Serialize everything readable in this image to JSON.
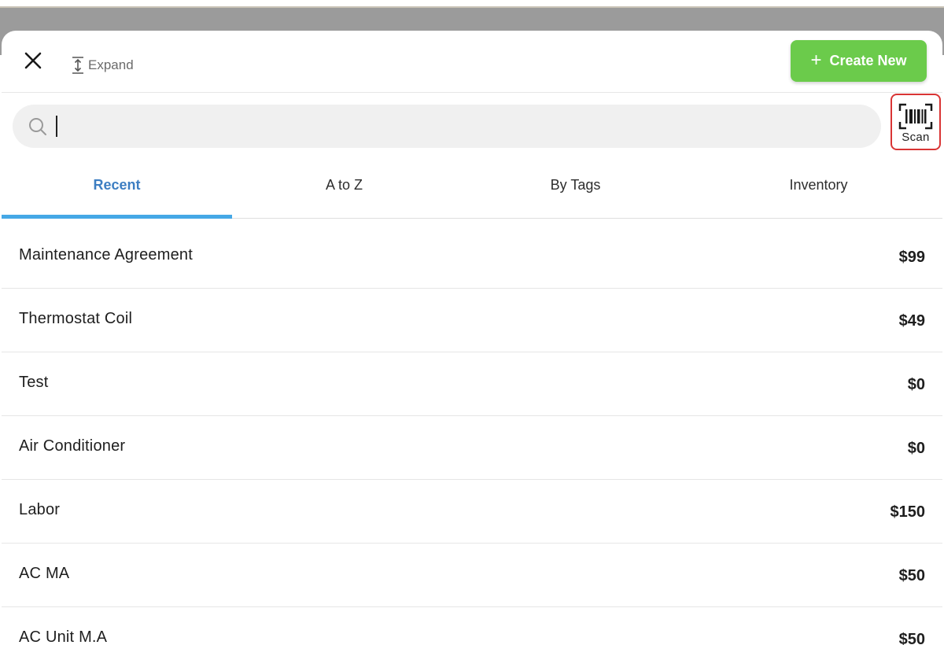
{
  "header": {
    "expand_label": "Expand",
    "create_label": "Create New",
    "create_color": "#6bcb4b"
  },
  "search": {
    "placeholder": "",
    "value": ""
  },
  "scan": {
    "label": "Scan",
    "highlight_color": "#d93535"
  },
  "tabs": [
    {
      "label": "Recent",
      "active": true
    },
    {
      "label": "A to Z",
      "active": false
    },
    {
      "label": "By Tags",
      "active": false
    },
    {
      "label": "Inventory",
      "active": false
    }
  ],
  "items": [
    {
      "name": "Maintenance Agreement",
      "price": "$99"
    },
    {
      "name": "Thermostat Coil",
      "price": "$49"
    },
    {
      "name": "Test",
      "price": "$0"
    },
    {
      "name": "Air Conditioner",
      "price": "$0"
    },
    {
      "name": "Labor",
      "price": "$150"
    },
    {
      "name": "AC MA",
      "price": "$50"
    },
    {
      "name": "AC Unit M.A",
      "price": "$50"
    }
  ],
  "colors": {
    "active_tab_text": "#3d7ec2",
    "active_tab_underline": "#45a8e6"
  }
}
